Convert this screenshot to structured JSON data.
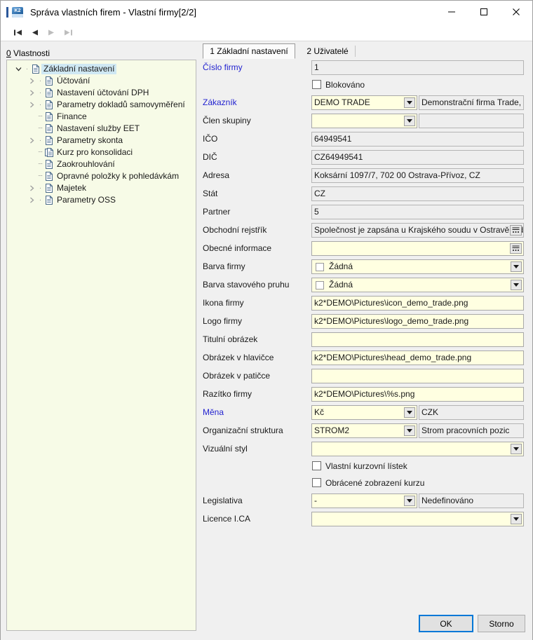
{
  "window": {
    "title": "Správa vlastních firem - Vlastní firmy[2/2]",
    "app_icon": "k2-app-icon",
    "minimize": "minimize-icon",
    "maximize": "maximize-icon",
    "close": "close-icon"
  },
  "toolbar": {
    "buttons": [
      {
        "name": "first-record",
        "icon": "skip-back-icon",
        "enabled": true
      },
      {
        "name": "previous-record",
        "icon": "previous-icon",
        "enabled": true
      },
      {
        "name": "next-record",
        "icon": "next-icon",
        "enabled": false
      },
      {
        "name": "last-record",
        "icon": "skip-forward-icon",
        "enabled": false
      }
    ]
  },
  "left": {
    "header_accesskey": "0",
    "header": " Vlastnosti",
    "tree": [
      {
        "label": "Základní nastavení",
        "level": 0,
        "expander": "expanded",
        "icon": "page-icon",
        "selected": true
      },
      {
        "label": "Účtování",
        "level": 1,
        "expander": "collapsed",
        "icon": "page-icon",
        "selected": false
      },
      {
        "label": "Nastavení účtování DPH",
        "level": 1,
        "expander": "collapsed",
        "icon": "page-icon",
        "selected": false
      },
      {
        "label": "Parametry dokladů samovyměření",
        "level": 1,
        "expander": "collapsed",
        "icon": "page-icon",
        "selected": false
      },
      {
        "label": "Finance",
        "level": 1,
        "expander": "leaf",
        "icon": "page-icon",
        "selected": false
      },
      {
        "label": "Nastavení služby EET",
        "level": 1,
        "expander": "leaf",
        "icon": "page-icon",
        "selected": false
      },
      {
        "label": "Parametry skonta",
        "level": 1,
        "expander": "collapsed",
        "icon": "page-icon",
        "selected": false
      },
      {
        "label": "Kurz pro konsolidaci",
        "level": 1,
        "expander": "leaf",
        "icon": "pages-icon",
        "selected": false
      },
      {
        "label": "Zaokrouhlování",
        "level": 1,
        "expander": "leaf",
        "icon": "page-icon",
        "selected": false
      },
      {
        "label": "Opravné položky k pohledávkám",
        "level": 1,
        "expander": "leaf",
        "icon": "page-icon",
        "selected": false
      },
      {
        "label": "Majetek",
        "level": 1,
        "expander": "collapsed",
        "icon": "page-icon",
        "selected": false
      },
      {
        "label": "Parametry OSS",
        "level": 1,
        "expander": "collapsed",
        "icon": "page-icon",
        "selected": false
      }
    ]
  },
  "tabs": [
    {
      "label": "1 Základní nastavení",
      "active": true
    },
    {
      "label": "2 Uživatelé",
      "active": false
    }
  ],
  "form": {
    "cislo_firmy": {
      "label": "Číslo firmy",
      "value": "1",
      "required": true,
      "readonly": true
    },
    "blokovano": {
      "label": "Blokováno",
      "checked": false
    },
    "zakaznik": {
      "label": "Zákazník",
      "value": "DEMO TRADE",
      "value2": "Demonstrační firma Trade, spo",
      "required": true
    },
    "clen_skupiny": {
      "label": "Člen skupiny",
      "value": "",
      "value2": "",
      "required": false
    },
    "ico": {
      "label": "IČO",
      "value": "64949541",
      "readonly": true
    },
    "dic": {
      "label": "DIČ",
      "value": "CZ64949541",
      "readonly": true
    },
    "adresa": {
      "label": "Adresa",
      "value": "Koksární 1097/7, 702 00  Ostrava-Přívoz, CZ",
      "readonly": true
    },
    "stat": {
      "label": "Stát",
      "value": "CZ",
      "readonly": true
    },
    "partner": {
      "label": "Partner",
      "value": "5",
      "readonly": true
    },
    "obchodni_rejstrik": {
      "label": "Obchodní rejstřík",
      "value": "Společnost je zapsána u Krajského soudu v Ostravě, odd"
    },
    "obecne_informace": {
      "label": "Obecné informace",
      "value": ""
    },
    "barva_firmy": {
      "label": "Barva firmy",
      "value": "Žádná"
    },
    "barva_stavoveho_pruhu": {
      "label": "Barva stavového pruhu",
      "value": "Žádná"
    },
    "ikona_firmy": {
      "label": "Ikona firmy",
      "value": "k2*DEMO\\Pictures\\icon_demo_trade.png"
    },
    "logo_firmy": {
      "label": "Logo firmy",
      "value": "k2*DEMO\\Pictures\\logo_demo_trade.png"
    },
    "titulni_obrazek": {
      "label": "Titulní obrázek",
      "value": ""
    },
    "obrazek_v_hlavicce": {
      "label": "Obrázek v hlavičce",
      "value": "k2*DEMO\\Pictures\\head_demo_trade.png"
    },
    "obrazek_v_paticce": {
      "label": "Obrázek v patičce",
      "value": ""
    },
    "razitko_firmy": {
      "label": "Razítko firmy",
      "value": "k2*DEMO\\Pictures\\%s.png"
    },
    "mena": {
      "label": "Měna",
      "value": "Kč",
      "value2": "CZK",
      "required": true
    },
    "organizacni_struktura": {
      "label": "Organizační struktura",
      "value": "STROM2",
      "value2": "Strom pracovních pozic"
    },
    "vizualni_styl": {
      "label": "Vizuální styl",
      "value": ""
    },
    "vlastni_kurzovni_listek": {
      "label": "Vlastní kurzovní lístek",
      "checked": false
    },
    "obracene_zobrazeni_kurzu": {
      "label": "Obrácené zobrazení kurzu",
      "checked": false
    },
    "legislativa": {
      "label": "Legislativa",
      "value": "-",
      "value2": "Nedefinováno"
    },
    "licence_ica": {
      "label": "Licence I.CA",
      "value": ""
    }
  },
  "footer": {
    "ok_label": "OK",
    "cancel_label": "Storno"
  },
  "colors": {
    "required_label": "#2323d0",
    "editable_field": "#ffffe1",
    "readonly_field": "#eeeeee",
    "tree_background": "#f7fbe7",
    "selection": "#cfe8f3",
    "focus_border": "#0078d7"
  }
}
